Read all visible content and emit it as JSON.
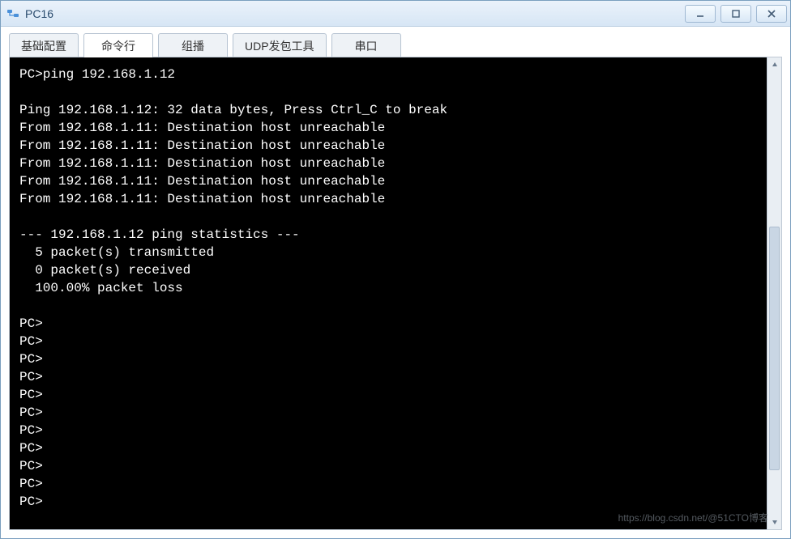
{
  "window": {
    "title": "PC16"
  },
  "tabs": [
    {
      "label": "基础配置",
      "active": false
    },
    {
      "label": "命令行",
      "active": true
    },
    {
      "label": "组播",
      "active": false
    },
    {
      "label": "UDP发包工具",
      "active": false
    },
    {
      "label": "串口",
      "active": false
    }
  ],
  "terminal": {
    "lines": [
      "PC>ping 192.168.1.12",
      "",
      "Ping 192.168.1.12: 32 data bytes, Press Ctrl_C to break",
      "From 192.168.1.11: Destination host unreachable",
      "From 192.168.1.11: Destination host unreachable",
      "From 192.168.1.11: Destination host unreachable",
      "From 192.168.1.11: Destination host unreachable",
      "From 192.168.1.11: Destination host unreachable",
      "",
      "--- 192.168.1.12 ping statistics ---",
      "  5 packet(s) transmitted",
      "  0 packet(s) received",
      "  100.00% packet loss",
      "",
      "PC>",
      "PC>",
      "PC>",
      "PC>",
      "PC>",
      "PC>",
      "PC>",
      "PC>",
      "PC>",
      "PC>",
      "PC>"
    ]
  },
  "watermark": "https://blog.csdn.net/@51CTO博客",
  "icons": {
    "app": "app-icon",
    "minimize": "minimize-icon",
    "maximize": "maximize-icon",
    "close": "close-icon",
    "scroll_up": "chevron-up-icon",
    "scroll_down": "chevron-down-icon"
  },
  "colors": {
    "title_bg_top": "#eaf2fb",
    "title_bg_bottom": "#d7e6f5",
    "border": "#7a9fbf",
    "terminal_bg": "#000000",
    "terminal_fg": "#ffffff"
  }
}
